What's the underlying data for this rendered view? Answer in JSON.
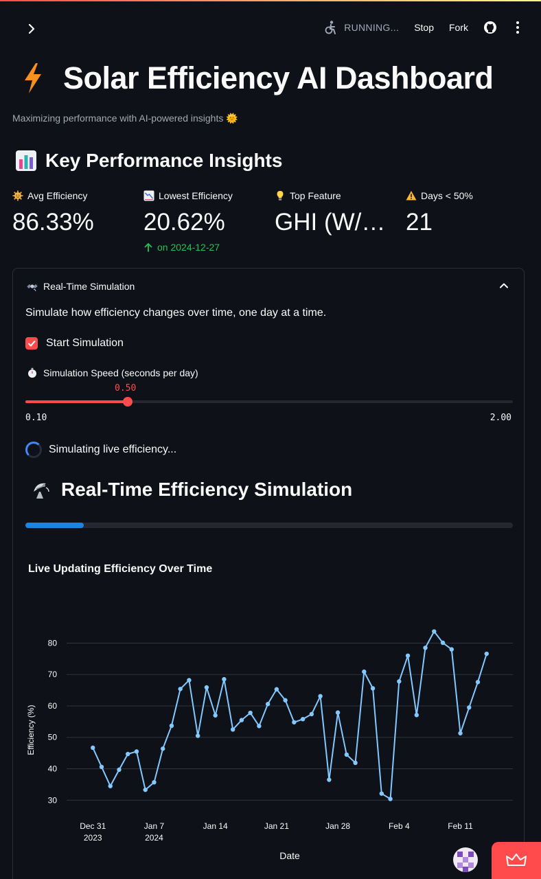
{
  "status_bar": {
    "running_label": "RUNNING...",
    "stop_label": "Stop",
    "fork_label": "Fork"
  },
  "header": {
    "title": "Solar Efficiency AI Dashboard",
    "subtitle": "Maximizing performance with AI-powered insights 🌞",
    "title_icon": "lightning-bolt-icon"
  },
  "kpi_section": {
    "title": "Key Performance Insights",
    "metrics": [
      {
        "label": "Avg Efficiency",
        "value": "86.33%",
        "icon": "sun-face-icon"
      },
      {
        "label": "Lowest Efficiency",
        "value": "20.62%",
        "delta": "on 2024-12-27",
        "icon": "chart-decreasing-icon"
      },
      {
        "label": "Top Feature",
        "value": "GHI (W/…",
        "icon": "lightbulb-icon"
      },
      {
        "label": "Days < 50%",
        "value": "21",
        "icon": "warning-icon"
      }
    ]
  },
  "simulation": {
    "expander_title": "Real-Time Simulation",
    "description": "Simulate how efficiency changes over time, one day at a time.",
    "checkbox_label": "Start Simulation",
    "checkbox_checked": true,
    "slider_label": "Simulation Speed (seconds per day)",
    "slider_value": "0.50",
    "slider_min": "0.10",
    "slider_max": "2.00",
    "slider_fraction": 0.2105,
    "spinner_text": "Simulating live efficiency...",
    "section_title": "Real-Time Efficiency Simulation",
    "progress_fraction": 0.12
  },
  "colors": {
    "accent": "#ff4b4b",
    "line": "#83c9ff",
    "progress": "#1c83e1",
    "delta_green": "#21c354",
    "background": "#0e1117"
  },
  "chart_data": {
    "type": "line",
    "title": "Live Updating Efficiency Over Time",
    "xlabel": "Date",
    "ylabel": "Efficiency (%)",
    "x": [
      "2023-12-31",
      "2024-01-01",
      "2024-01-02",
      "2024-01-03",
      "2024-01-04",
      "2024-01-05",
      "2024-01-06",
      "2024-01-07",
      "2024-01-08",
      "2024-01-09",
      "2024-01-10",
      "2024-01-11",
      "2024-01-12",
      "2024-01-13",
      "2024-01-14",
      "2024-01-15",
      "2024-01-16",
      "2024-01-17",
      "2024-01-18",
      "2024-01-19",
      "2024-01-20",
      "2024-01-21",
      "2024-01-22",
      "2024-01-23",
      "2024-01-24",
      "2024-01-25",
      "2024-01-26",
      "2024-01-27",
      "2024-01-28",
      "2024-01-29",
      "2024-01-30",
      "2024-01-31",
      "2024-02-01",
      "2024-02-02",
      "2024-02-03",
      "2024-02-04",
      "2024-02-05",
      "2024-02-06",
      "2024-02-07",
      "2024-02-08",
      "2024-02-09",
      "2024-02-10",
      "2024-02-11",
      "2024-02-12",
      "2024-02-13",
      "2024-02-14",
      "2024-02-15"
    ],
    "values": [
      46.7,
      40.6,
      34.5,
      39.7,
      44.7,
      45.5,
      33.3,
      35.7,
      46.4,
      53.7,
      65.4,
      68.2,
      50.5,
      65.9,
      57.0,
      68.5,
      52.5,
      55.5,
      57.8,
      53.6,
      60.6,
      65.3,
      61.8,
      54.8,
      55.8,
      57.4,
      63.1,
      36.5,
      57.9,
      44.5,
      41.9,
      70.9,
      65.6,
      32.1,
      30.4,
      67.8,
      76.0,
      57.1,
      78.5,
      83.7,
      80.1,
      78.0,
      51.3,
      59.5,
      67.6,
      76.6
    ],
    "x_ticks": [
      {
        "date": "2023-12-31",
        "line1": "Dec 31",
        "line2": "2023"
      },
      {
        "date": "2024-01-07",
        "line1": "Jan 7",
        "line2": "2024"
      },
      {
        "date": "2024-01-14",
        "line1": "Jan 14",
        "line2": ""
      },
      {
        "date": "2024-01-21",
        "line1": "Jan 21",
        "line2": ""
      },
      {
        "date": "2024-01-28",
        "line1": "Jan 28",
        "line2": ""
      },
      {
        "date": "2024-02-04",
        "line1": "Feb 4",
        "line2": ""
      },
      {
        "date": "2024-02-11",
        "line1": "Feb 11",
        "line2": ""
      }
    ],
    "y_ticks": [
      30,
      40,
      50,
      60,
      70,
      80
    ],
    "ylim": [
      27,
      86
    ],
    "xlim": [
      "2023-12-28",
      "2024-02-17"
    ],
    "grid": true
  }
}
